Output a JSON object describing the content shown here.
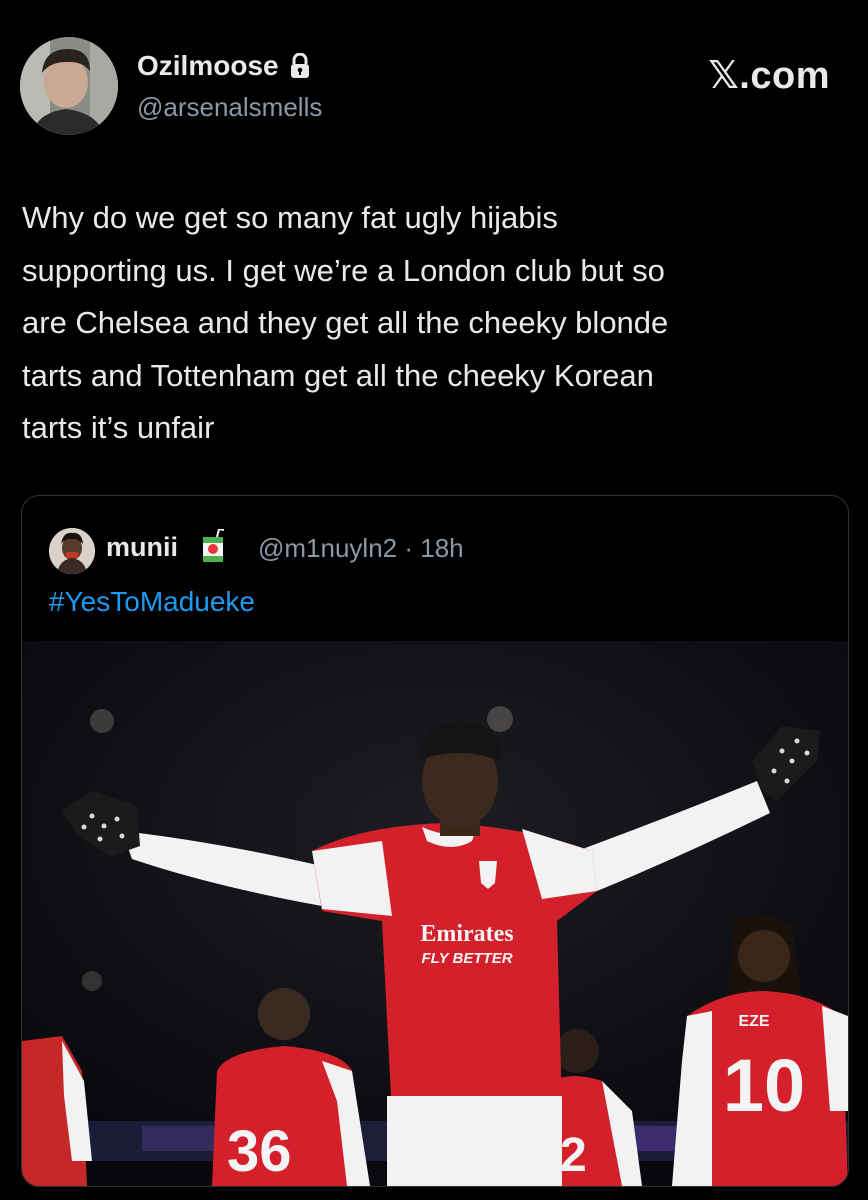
{
  "author": {
    "display_name": "Ozilmoose",
    "handle": "@arsenalsmells",
    "protected_icon": "lock-icon"
  },
  "brand": {
    "label": "𝕏.com"
  },
  "tweet": {
    "lines": [
      "Why do we get so many fat ugly hijabis",
      "supporting us. I get we’re a London club but so",
      "are Chelsea and they get all the cheeky blonde",
      "tarts and Tottenham get all the cheeky Korean",
      "tarts it’s unfair"
    ]
  },
  "quoted": {
    "display_name": "munii",
    "emoji_icon": "juice-box-icon",
    "handle_time": "@m1nuyln2 · 18h",
    "hashtag": "#YesToMadueke",
    "image": {
      "jersey_sponsor_line1": "Emirates",
      "jersey_sponsor_line2": "FLY BETTER",
      "player_right_name": "EZE",
      "player_right_number": "10",
      "player_left_number": "36",
      "player_mid_number": "2"
    }
  },
  "colors": {
    "background": "#000000",
    "text": "#e7e9ea",
    "secondary_text": "#8b98a5",
    "link": "#1d9bf0",
    "border": "#2f3336",
    "kit_red": "#d3202a"
  }
}
